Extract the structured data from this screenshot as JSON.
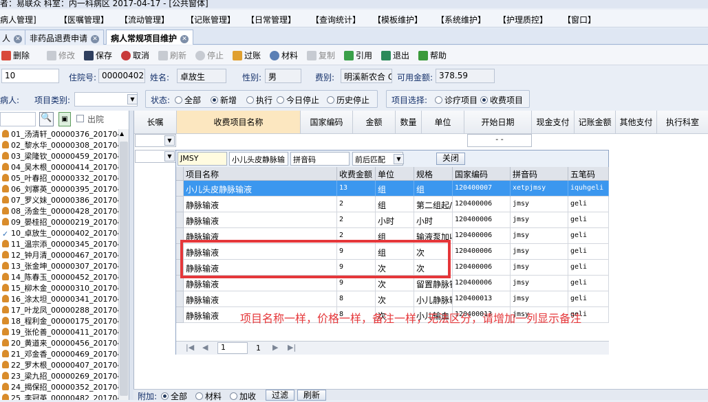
{
  "window_title": "者：易联众  科室：内一科病区  2017-04-17 - [公共窗体]",
  "menu": [
    "病人管理]",
    "【医嘱管理】",
    "【流动管理】",
    "【记账管理】",
    "【日常管理】",
    "【查询统计】",
    "【模板维护】",
    "【系统维护】",
    "【护理质控】",
    "【窗口】"
  ],
  "tabs": [
    {
      "label": "人"
    },
    {
      "label": "非药品退费申请"
    },
    {
      "label": "病人常规项目维护"
    }
  ],
  "toolbar": {
    "delete": "删除",
    "modify": "修改",
    "save": "保存",
    "cancel": "取消",
    "refresh": "刷新",
    "stop": "停止",
    "post": "过账",
    "material": "材料",
    "copy": "复制",
    "quote": "引用",
    "exit": "退出",
    "help": "帮助"
  },
  "info": {
    "bed_value": "10",
    "admission_label": "住院号:",
    "admission_value": "00000402",
    "name_label": "姓名:",
    "name_value": "卓放生",
    "gender_label": "性别:",
    "gender_value": "男",
    "fee_label": "费别:",
    "fee_value": "明溪新农合 C",
    "balance_label": "可用金额:",
    "balance_value": "378.59"
  },
  "filters": {
    "patient_label": "病人:",
    "category_label": "项目类别:",
    "status_label": "状态:",
    "status_options": [
      "全部",
      "新增",
      "执行",
      "今日停止",
      "历史停止"
    ],
    "status_selected": 1,
    "item_select_label": "项目选择:",
    "item_options": [
      "诊疗项目",
      "收费项目"
    ],
    "item_selected": 1
  },
  "left_panel": {
    "discharge_label": "出院",
    "patients": [
      "01_汤清轩_00000376_201704",
      "02_黎水华_00000308_201704",
      "03_梁隆钦_00000459_201704",
      "04_吴木根_00000414_201704",
      "05_叶春招_00000332_201704",
      "06_刘寨英_00000395_201704",
      "07_罗义妹_00000386_201704",
      "08_汤金生_00000428_201704",
      "09_晏桂招_00000219_201704",
      "10_卓放生_00000402_201704",
      "11_温宗添_00000345_201704",
      "12_钟月清_00000467_201704",
      "13_张金坤_00000307_201704",
      "14_陈春玉_00000452_201704",
      "15_柳木金_00000310_201704",
      "16_涂太坦_00000341_201704",
      "17_叶龙凤_00000288_201704",
      "18_程利金_00000175_201704",
      "19_张伦善_00000411_201704",
      "20_黄道来_00000456_201704",
      "21_邓金香_00000469_201704",
      "22_罗木根_00000407_201704",
      "23_梁九招_00000269_201704",
      "24_揭保招_00000352_201704",
      "25_李冠英_00000482_201704"
    ]
  },
  "grid": {
    "headers": [
      "长嘱",
      "收费项目名称",
      "国家编码",
      "金额",
      "数量",
      "单位",
      "开始日期",
      "现金支付",
      "记账金额",
      "其他支付",
      "执行科室"
    ],
    "date_placeholder": "-   -"
  },
  "popup": {
    "search_text": "JMSY",
    "selected_name": "小儿头皮静脉输",
    "match_type": "拼音码",
    "match_mode": "前后匹配",
    "close_label": "关闭",
    "columns": [
      "项目名称",
      "收费金额",
      "单位",
      "规格",
      "国家编码",
      "拼音码",
      "五笔码"
    ],
    "rows": [
      [
        "小儿头皮静脉输液",
        "13",
        "组",
        "组",
        "120400007",
        "xetpjmsy",
        "iquhgeli"
      ],
      [
        "静脉输液",
        "2",
        "组",
        "第二组起/",
        "120400006",
        "jmsy",
        "geli"
      ],
      [
        "静脉输液",
        "2",
        "小时",
        "小时",
        "120400006",
        "jmsy",
        "geli"
      ],
      [
        "静脉输液",
        "2",
        "组",
        "输液泵加收",
        "120400006",
        "jmsy",
        "geli"
      ],
      [
        "静脉输液",
        "9",
        "组",
        "次",
        "120400006",
        "jmsy",
        "geli"
      ],
      [
        "静脉输液",
        "9",
        "次",
        "次",
        "120400006",
        "jmsy",
        "geli"
      ],
      [
        "静脉输液",
        "9",
        "次",
        "留置静脉针",
        "120400006",
        "jmsy",
        "geli"
      ],
      [
        "静脉输液",
        "8",
        "次",
        "小儿静脉输",
        "120400013",
        "jmsy",
        "geli"
      ],
      [
        "静脉输液",
        "8",
        "次",
        "小儿输血",
        "120400013",
        "jmsy",
        "geli"
      ]
    ],
    "page_value": "1",
    "page_total": "1"
  },
  "annotation": "项目名称一样，价格一样，备注一样，无法区分，请增加一列显示备注",
  "bottom": {
    "attach_label": "附加:",
    "options": [
      "全部",
      "材料",
      "加收"
    ],
    "filter_button": "过滤",
    "refresh_button": "刷新"
  },
  "colors": {
    "highlight": "#3b97ef",
    "annotation_red": "#e5373a",
    "selected_header": "#fce7c0"
  }
}
